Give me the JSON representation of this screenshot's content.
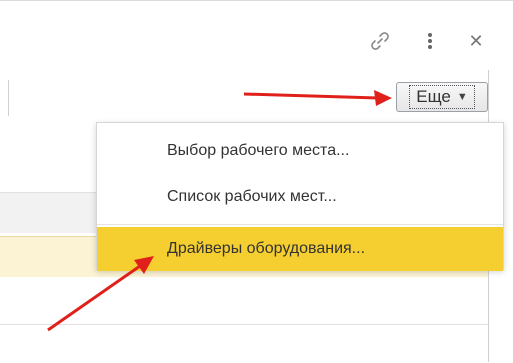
{
  "toolbar": {
    "more_label": "Еще",
    "icons": [
      "link-icon",
      "more-vertical-icon",
      "close-icon"
    ]
  },
  "menu": {
    "items": [
      {
        "label": "Выбор рабочего места..."
      },
      {
        "label": "Список рабочих мест..."
      },
      {
        "label": "Драйверы оборудования...",
        "highlighted": true
      }
    ]
  },
  "colors": {
    "highlight": "#f5cf30",
    "selected_row": "#fbf3d4",
    "arrow": "#e0201b"
  }
}
